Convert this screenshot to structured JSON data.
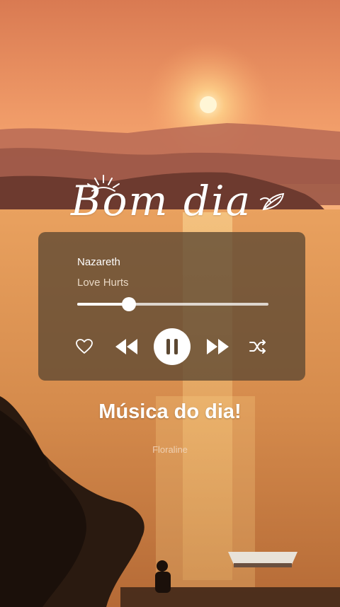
{
  "greeting": {
    "text": "Bom dia"
  },
  "player": {
    "artist": "Nazareth",
    "track": "Love Hurts",
    "progress": 0.27,
    "icons": {
      "like": "heart-icon",
      "previous": "rewind-icon",
      "play_pause": "pause-icon",
      "next": "fast-forward-icon",
      "shuffle": "shuffle-icon"
    }
  },
  "title": "Música do dia!",
  "author": "Floraline",
  "colors": {
    "sky_top": "#e48a5a",
    "sky_horizon": "#f6a469",
    "sun": "#fff2c8",
    "water": "#e19a5a",
    "player_bg": "#5c4832"
  }
}
